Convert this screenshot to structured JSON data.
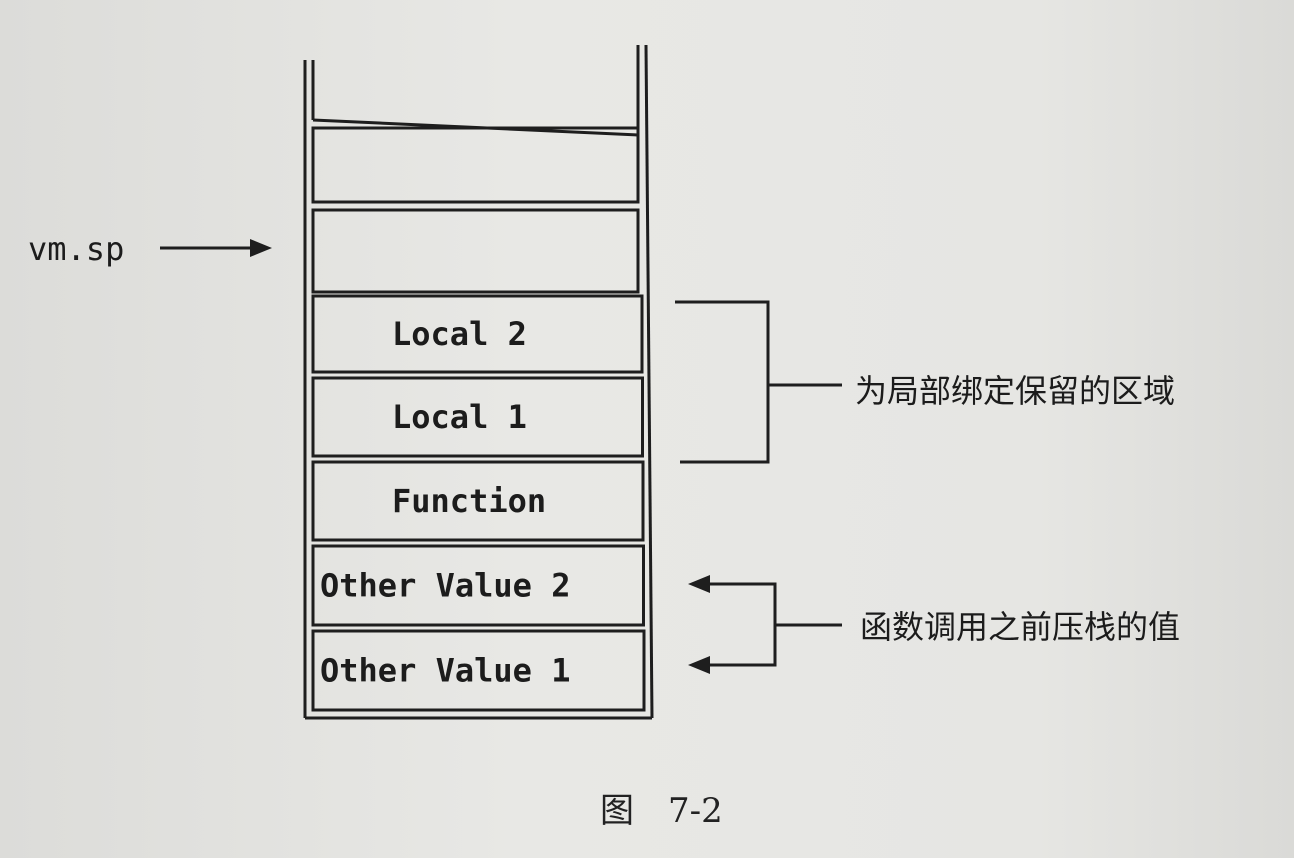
{
  "diagram": {
    "pointer_label": "vm.sp",
    "stack_cells": [
      "",
      "",
      "Local 2",
      "Local 1",
      "Function",
      "Other Value 2",
      "Other Value 1"
    ],
    "annotations": {
      "locals_region": "为局部绑定保留的区域",
      "pushed_values": "函数调用之前压栈的值"
    },
    "caption": "图　7-2"
  }
}
